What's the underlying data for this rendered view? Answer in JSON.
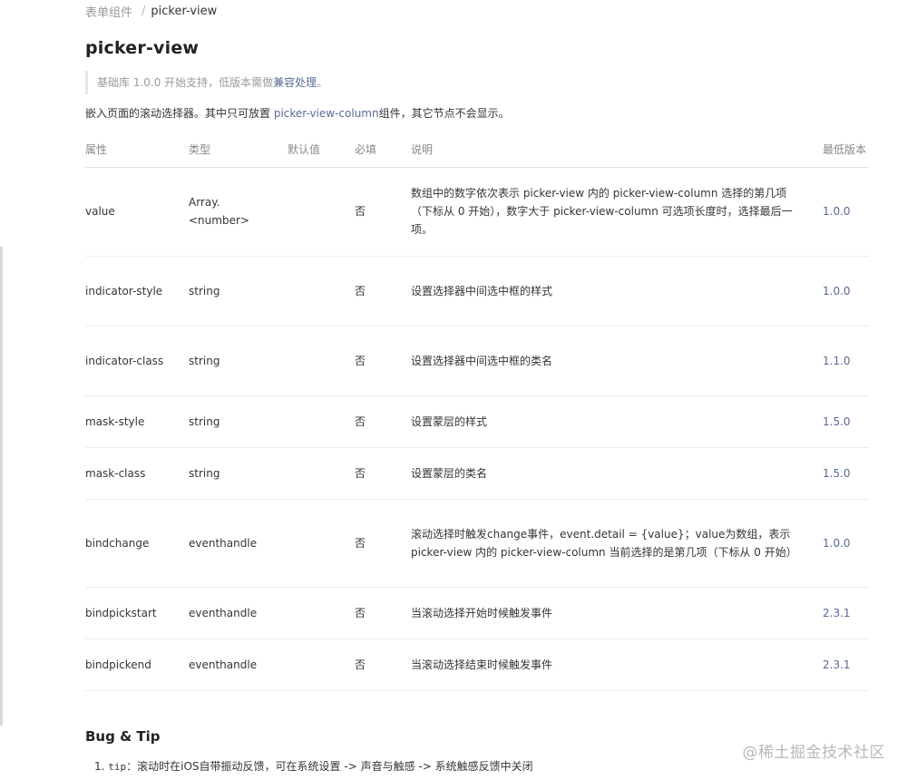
{
  "breadcrumb": {
    "parent": "表单组件",
    "separator": "/",
    "current": "picker-view"
  },
  "title": "picker-view",
  "note": {
    "text": "基础库 1.0.0 开始支持，低版本需做",
    "link": "兼容处理",
    "end": "。"
  },
  "description": {
    "before": "嵌入页面的滚动选择器。其中只可放置 ",
    "link": "picker-view-column",
    "after": "组件，其它节点不会显示。"
  },
  "table": {
    "headers": [
      "属性",
      "类型",
      "默认值",
      "必填",
      "说明",
      "最低版本"
    ],
    "rows": [
      {
        "attr": "value",
        "type": "Array.<number>",
        "default": "",
        "required": "否",
        "desc": "数组中的数字依次表示 picker-view 内的 picker-view-column 选择的第几项（下标从 0 开始），数字大于 picker-view-column 可选项长度时，选择最后一项。",
        "version": "1.0.0"
      },
      {
        "attr": "indicator-style",
        "type": "string",
        "default": "",
        "required": "否",
        "desc": "设置选择器中间选中框的样式",
        "version": "1.0.0"
      },
      {
        "attr": "indicator-class",
        "type": "string",
        "default": "",
        "required": "否",
        "desc": "设置选择器中间选中框的类名",
        "version": "1.1.0"
      },
      {
        "attr": "mask-style",
        "type": "string",
        "default": "",
        "required": "否",
        "desc": "设置蒙层的样式",
        "version": "1.5.0"
      },
      {
        "attr": "mask-class",
        "type": "string",
        "default": "",
        "required": "否",
        "desc": "设置蒙层的类名",
        "version": "1.5.0"
      },
      {
        "attr": "bindchange",
        "type": "eventhandle",
        "default": "",
        "required": "否",
        "desc": "滚动选择时触发change事件，event.detail = {value}；value为数组，表示 picker-view 内的 picker-view-column 当前选择的是第几项（下标从 0 开始）",
        "version": "1.0.0"
      },
      {
        "attr": "bindpickstart",
        "type": "eventhandle",
        "default": "",
        "required": "否",
        "desc": "当滚动选择开始时候触发事件",
        "version": "2.3.1"
      },
      {
        "attr": "bindpickend",
        "type": "eventhandle",
        "default": "",
        "required": "否",
        "desc": "当滚动选择结束时候触发事件",
        "version": "2.3.1"
      }
    ]
  },
  "bug_tip": {
    "title": "Bug & Tip",
    "items": [
      {
        "number": "1.",
        "code": "tip",
        "text": "：滚动时在iOS自带振动反馈，可在系统设置 -> 声音与触感 -> 系统触感反馈中关闭"
      }
    ]
  },
  "watermark": "@稀土掘金技术社区"
}
